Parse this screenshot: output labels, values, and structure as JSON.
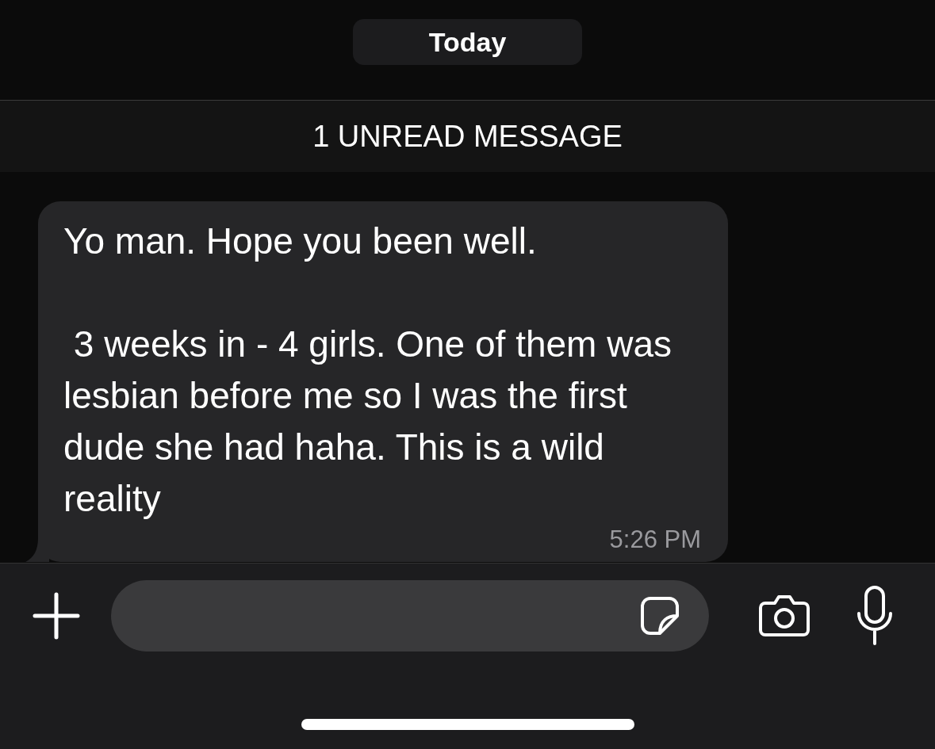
{
  "date_chip": "Today",
  "unread_banner": "1 UNREAD MESSAGE",
  "messages": [
    {
      "text": "Yo man. Hope you been well.\n\n 3 weeks in - 4 girls. One of them was lesbian before me so I was the first dude she had haha. This is a wild reality",
      "time": "5:26 PM"
    }
  ]
}
